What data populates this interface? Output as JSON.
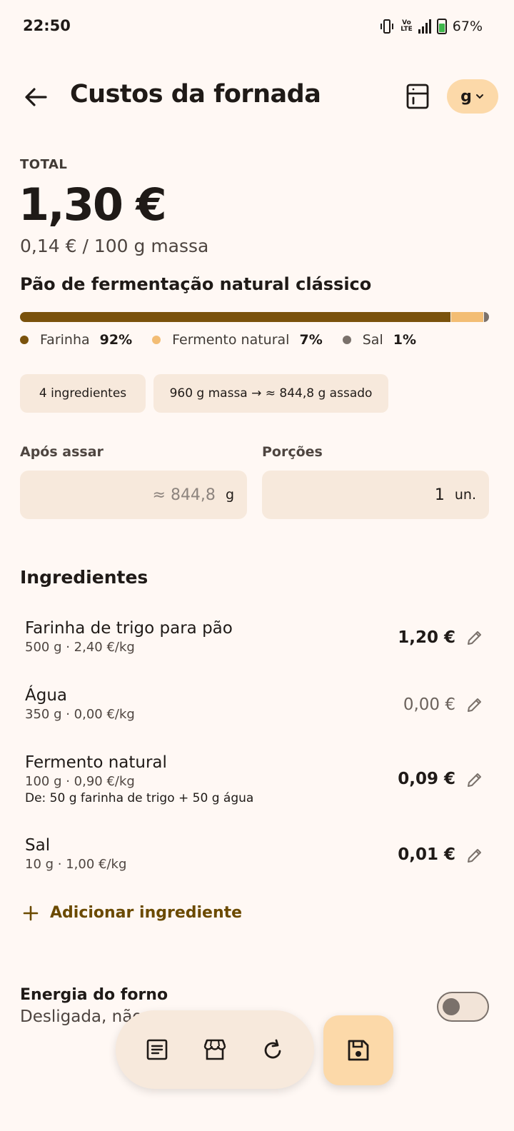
{
  "status_bar": {
    "time": "22:50",
    "battery": "67%",
    "network_label_top": "Vo",
    "network_label_bottom": "LTE"
  },
  "app_bar": {
    "title": "Custos da fornada",
    "unit_selector": "g"
  },
  "summary": {
    "total_label": "TOTAL",
    "total_value": "1,30 €",
    "per_mass": "0,14 € / 100 g massa",
    "recipe_name": "Pão de fermentação natural clássico"
  },
  "composition": [
    {
      "name": "Farinha",
      "pct_label": "92%",
      "fraction": 0.92,
      "color": "#7a520c"
    },
    {
      "name": "Fermento natural",
      "pct_label": "7%",
      "fraction": 0.07,
      "color": "#f3bd74"
    },
    {
      "name": "Sal",
      "pct_label": "1%",
      "fraction": 0.01,
      "color": "#7a716b"
    }
  ],
  "chips": {
    "ingredients_count": "4 ingredientes",
    "mass_info": "960 g massa → ≈ 844,8 g assado"
  },
  "fields": {
    "after_baking_label": "Após assar",
    "after_baking_value": "≈ 844,8",
    "after_baking_unit": "g",
    "portions_label": "Porções",
    "portions_value": "1",
    "portions_unit": "un."
  },
  "ingredients_section": {
    "title": "Ingredientes",
    "add_label": "Adicionar ingrediente"
  },
  "ingredients": [
    {
      "name": "Farinha de trigo para pão",
      "detail": "500 g · 2,40 €/kg",
      "extra": "",
      "price": "1,20 €"
    },
    {
      "name": "Água",
      "detail": "350 g · 0,00 €/kg",
      "extra": "",
      "price": "0,00 €"
    },
    {
      "name": "Fermento natural",
      "detail": "100 g · 0,90 €/kg",
      "extra": "De: 50 g farinha de trigo + 50 g água",
      "price": "0,09 €"
    },
    {
      "name": "Sal",
      "detail": "10 g · 1,00 €/kg",
      "extra": "",
      "price": "0,01 €"
    }
  ],
  "energy": {
    "title": "Energia do forno",
    "subtitle": "Desligada, não"
  },
  "colors": {
    "accent": "#6b4a00",
    "chip_bg": "#f7e9dc",
    "fab_bg": "#fcd9a9",
    "background": "#fff8f4"
  },
  "icons": {
    "back": "arrow-left-icon",
    "calculator": "calculator-icon",
    "dock": [
      "notes-icon",
      "store-icon",
      "refresh-icon"
    ],
    "fab": "save-icon"
  }
}
